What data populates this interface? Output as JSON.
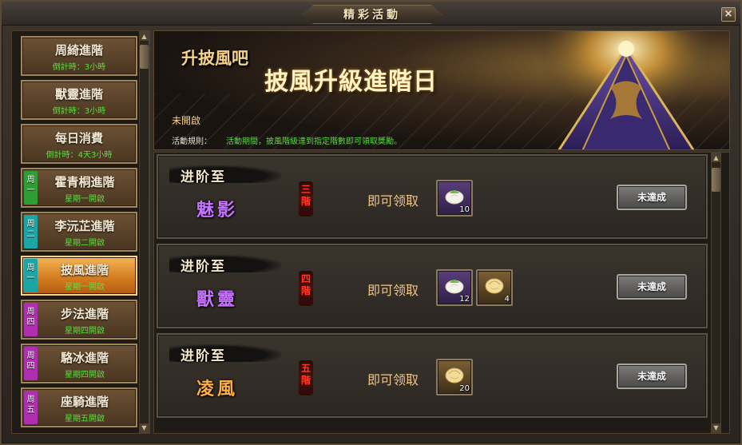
{
  "window": {
    "title": "精彩活動",
    "close_label": "×"
  },
  "sidebar": {
    "items": [
      {
        "name": "周綺進階",
        "sub": "倒計時：3小時",
        "tag": ""
      },
      {
        "name": "獸靈進階",
        "sub": "倒計時：3小時",
        "tag": ""
      },
      {
        "name": "每日消費",
        "sub": "倒計時：4天3小時",
        "tag": ""
      },
      {
        "name": "霍青桐進階",
        "sub": "星期一開啟",
        "tag": "周一",
        "tag_color": "#2e9e34"
      },
      {
        "name": "李沅芷進階",
        "sub": "星期二開啟",
        "tag": "周二",
        "tag_color": "#1ba5a5"
      },
      {
        "name": "披風進階",
        "sub": "星期一開啟",
        "tag": "周一",
        "tag_color": "#1ba5a5",
        "active": true
      },
      {
        "name": "步法進階",
        "sub": "星期四開啟",
        "tag": "周四",
        "tag_color": "#b02eb0"
      },
      {
        "name": "駱冰進階",
        "sub": "星期四開啟",
        "tag": "周四",
        "tag_color": "#b02eb0"
      },
      {
        "name": "座騎進階",
        "sub": "星期五開啟",
        "tag": "周五",
        "tag_color": "#b02eb0"
      }
    ],
    "scroll_up": "▲",
    "scroll_down": "▼"
  },
  "banner": {
    "subtitle": "升披風吧",
    "title": "披風升級進階日",
    "status": "未開啟",
    "rule_label": "活動規則：",
    "rule_text": "活動期間，披風階級達到指定階數即可領取獎勵。"
  },
  "rewards": {
    "rows": [
      {
        "label": "进阶至",
        "level_name": "魅影",
        "level_color": "#c673ff",
        "stage": "三階",
        "claim": "即可领取",
        "items": [
          {
            "kind": "bun",
            "count": "10"
          }
        ],
        "button": "未達成"
      },
      {
        "label": "进阶至",
        "level_name": "獸靈",
        "level_color": "#c673ff",
        "stage": "四階",
        "claim": "即可领取",
        "items": [
          {
            "kind": "bun",
            "count": "12"
          },
          {
            "kind": "dumpling",
            "count": "4"
          }
        ],
        "button": "未達成"
      },
      {
        "label": "进阶至",
        "level_name": "凌風",
        "level_color": "#ffb043",
        "stage": "五階",
        "claim": "即可领取",
        "items": [
          {
            "kind": "dumpling",
            "count": "20"
          }
        ],
        "button": "未達成"
      }
    ]
  }
}
